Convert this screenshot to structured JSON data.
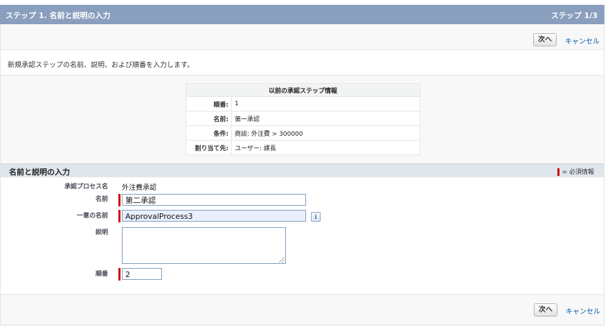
{
  "header": {
    "title": "ステップ 1. 名前と説明の入力",
    "step": "ステップ 1/3"
  },
  "buttons": {
    "next": "次へ",
    "cancel": "キャンセル"
  },
  "intro": "新規承認ステップの名前、説明、および順番を入力します。",
  "previous_step": {
    "title": "以前の承認ステップ情報",
    "rows": [
      {
        "label": "順番:",
        "value": "1"
      },
      {
        "label": "名前:",
        "value": "第一承認"
      },
      {
        "label": "条件:",
        "value": "商談: 外注費 > 300000"
      },
      {
        "label": "割り当て先:",
        "value": "ユーザー: 課長"
      }
    ]
  },
  "section": {
    "title": "名前と説明の入力",
    "required_legend": "= 必須情報"
  },
  "form": {
    "process_label": "承認プロセス名",
    "process_value": "外注費承認",
    "name_label": "名前",
    "name_value": "第二承認",
    "unique_name_label": "一意の名前",
    "unique_name_value": "ApprovalProcess3",
    "info_icon": "i",
    "description_label": "説明",
    "description_value": "",
    "order_label": "順番",
    "order_value": "2"
  },
  "colors": {
    "header_bg": "#8a9ebe",
    "section_bg": "#dfe6ec",
    "required": "#cc0000",
    "link": "#015ba7"
  }
}
